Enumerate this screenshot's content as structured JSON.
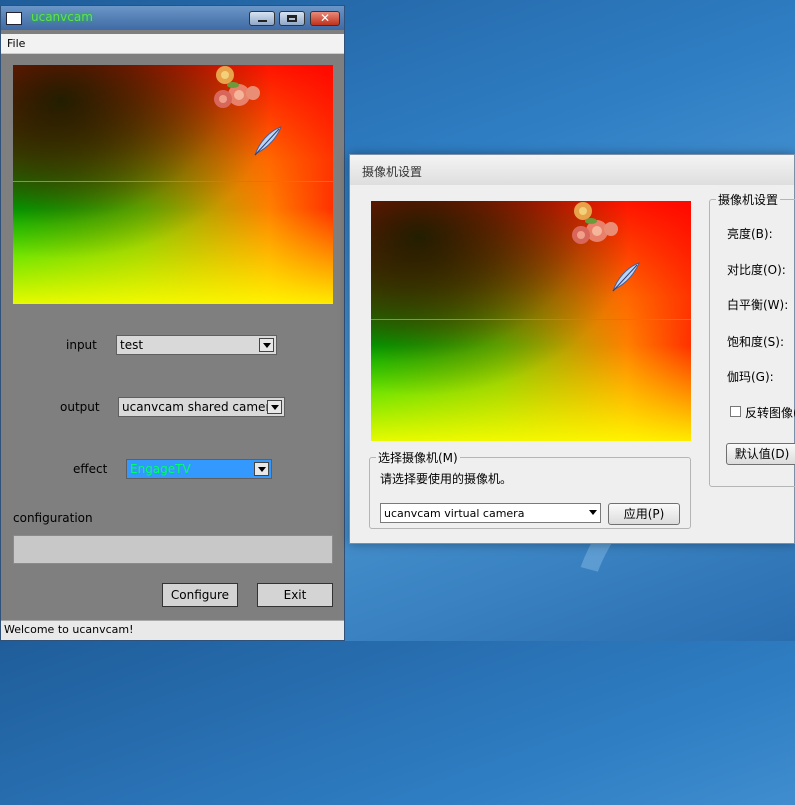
{
  "main_window": {
    "title": "ucanvcam",
    "menu": {
      "file": "File"
    },
    "input": {
      "label": "input",
      "value": "test"
    },
    "output": {
      "label": "output",
      "value": "ucanvcam shared camera"
    },
    "effect": {
      "label": "effect",
      "value": "EngageTV"
    },
    "configuration": {
      "label": "configuration",
      "value": ""
    },
    "buttons": {
      "configure": "Configure",
      "exit": "Exit"
    },
    "status": "Welcome to ucanvcam!"
  },
  "camera_dialog": {
    "title": "摄像机设置",
    "select_group": {
      "label": "选择摄像机(M)",
      "instruction": "请选择要使用的摄像机。",
      "camera": "ucanvcam virtual camera",
      "apply": "应用(P)"
    },
    "settings_group": {
      "label": "摄像机设置",
      "brightness": "亮度(B):",
      "contrast": "对比度(O):",
      "white_balance": "白平衡(W):",
      "saturation": "饱和度(S):",
      "gamma": "伽玛(G):",
      "flip": "反转图像(",
      "default": "默认值(D)"
    }
  },
  "colors": {
    "title_green": "#62e24a",
    "effect_highlight": "#3399ff",
    "effect_text": "#00ff66"
  }
}
